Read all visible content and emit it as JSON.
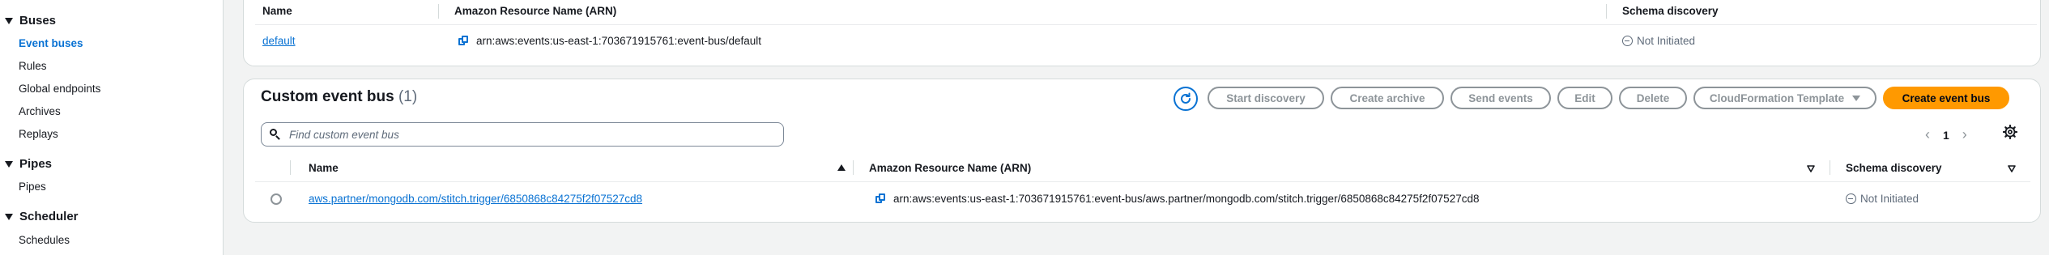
{
  "sidebar": {
    "sections": [
      {
        "label": "Buses",
        "items": [
          "Event buses",
          "Rules",
          "Global endpoints",
          "Archives",
          "Replays"
        ]
      },
      {
        "label": "Pipes",
        "items": [
          "Pipes"
        ]
      },
      {
        "label": "Scheduler",
        "items": [
          "Schedules"
        ]
      }
    ],
    "active_item": "Event buses"
  },
  "default_bus": {
    "columns": [
      "Name",
      "Amazon Resource Name (ARN)",
      "Schema discovery"
    ],
    "row": {
      "name": "default",
      "arn": "arn:aws:events:us-east-1:703671915761:event-bus/default",
      "schema_discovery": "Not Initiated"
    }
  },
  "custom_bus": {
    "title": "Custom event bus",
    "count": "(1)",
    "buttons": {
      "start_discovery": "Start discovery",
      "create_archive": "Create archive",
      "send_events": "Send events",
      "edit": "Edit",
      "delete": "Delete",
      "cloudformation": "CloudFormation Template",
      "create": "Create event bus"
    },
    "search_placeholder": "Find custom event bus",
    "page": "1",
    "columns": [
      "Name",
      "Amazon Resource Name (ARN)",
      "Schema discovery"
    ],
    "rows": [
      {
        "name": "aws.partner/mongodb.com/stitch.trigger/6850868c84275f2f07527cd8",
        "arn": "arn:aws:events:us-east-1:703671915761:event-bus/aws.partner/mongodb.com/stitch.trigger/6850868c84275f2f07527cd8",
        "schema_discovery": "Not Initiated"
      }
    ]
  },
  "colors": {
    "accent": "#0972d3",
    "primary_button": "#ff9900",
    "disabled": "#8d9499",
    "background": "#f2f3f3"
  },
  "icons": [
    "caret-down-icon",
    "copy-icon",
    "status-not-initiated-icon",
    "refresh-icon",
    "search-icon",
    "chevron-left-icon",
    "chevron-right-icon",
    "settings-gear-icon",
    "sort-ascending-icon",
    "sort-filter-icon",
    "dropdown-triangle-icon"
  ]
}
